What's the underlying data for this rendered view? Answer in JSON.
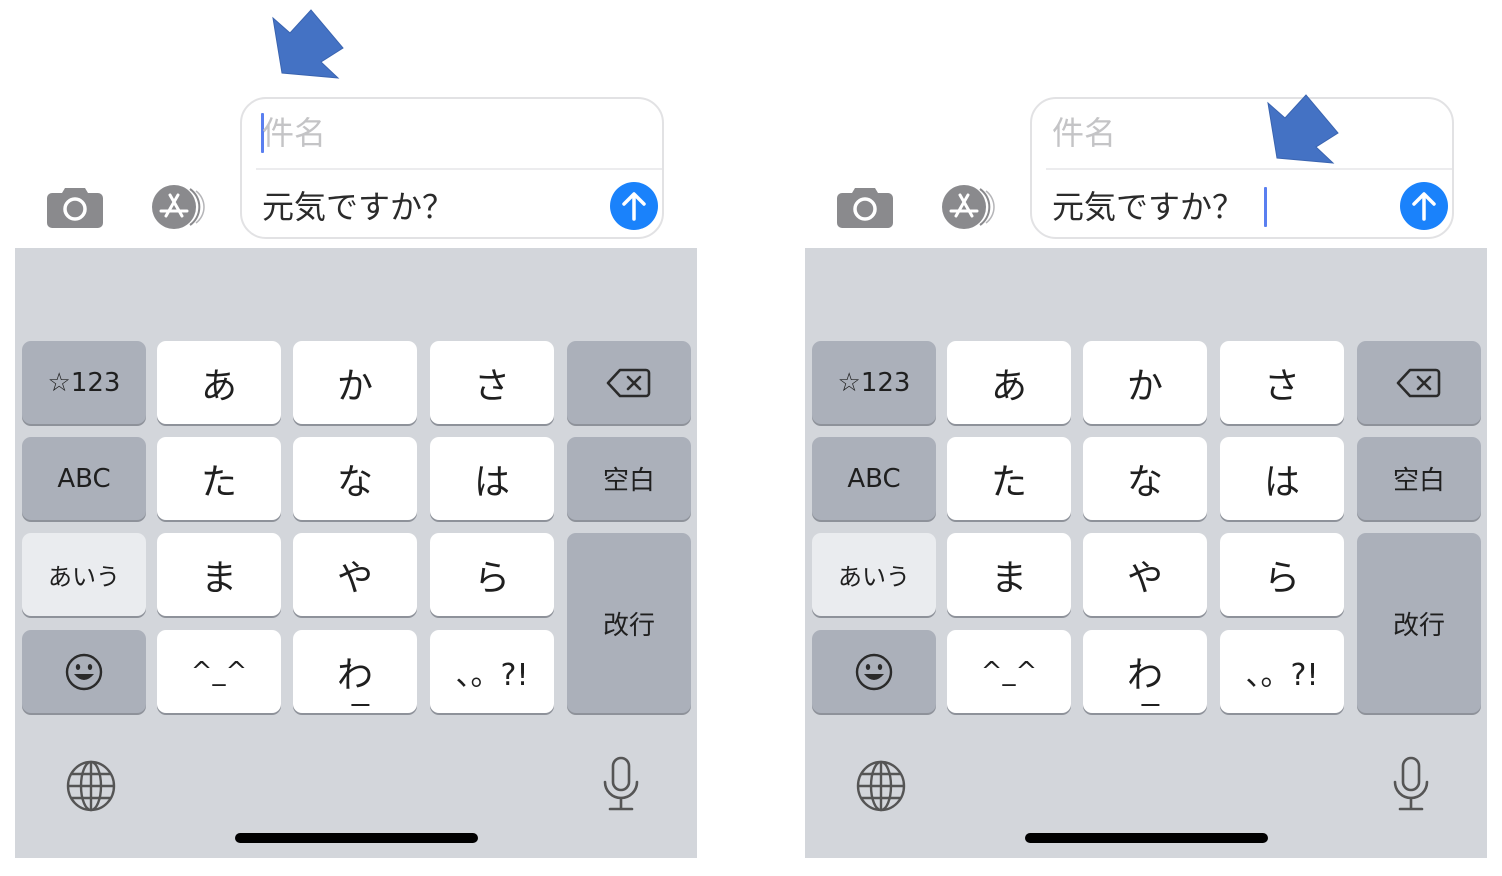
{
  "colors": {
    "accent_blue": "#1a82fb",
    "caret_blue": "#5a7ff0",
    "annotation_arrow": "#4472c4",
    "keyboard_bg": "#d3d6db",
    "function_key": "#abb0ba",
    "char_key": "#ffffff"
  },
  "panels": [
    {
      "id": "before",
      "caret_position": "subject",
      "compose": {
        "subject_placeholder": "件名",
        "message_text": "元気ですか？"
      }
    },
    {
      "id": "after",
      "caret_position": "message-end",
      "compose": {
        "subject_placeholder": "件名",
        "message_text": "元気ですか？"
      }
    }
  ],
  "toolbar": {
    "camera_icon": "camera-icon",
    "appstore_icon": "app-store-icon",
    "send_icon": "arrow-up-icon"
  },
  "keyboard": {
    "rows": [
      [
        "☆123",
        "あ",
        "か",
        "さ",
        "delete"
      ],
      [
        "ABC",
        "た",
        "な",
        "は",
        "空白"
      ],
      [
        "あいう",
        "ま",
        "や",
        "ら",
        "改行"
      ],
      [
        "emoji",
        "^^",
        "わ",
        "、。?!"
      ]
    ],
    "keys": {
      "symbols": "☆123",
      "a": "あ",
      "ka": "か",
      "sa": "さ",
      "abc": "ABC",
      "ta": "た",
      "na": "な",
      "ha": "は",
      "space": "空白",
      "kana": "あいう",
      "ma": "ま",
      "ya": "や",
      "ra": "ら",
      "return": "改行",
      "kaomoji": "^_^",
      "wa": "わ",
      "punct": "、。?!"
    },
    "bottom": {
      "globe_icon": "globe-icon",
      "mic_icon": "microphone-icon"
    }
  }
}
